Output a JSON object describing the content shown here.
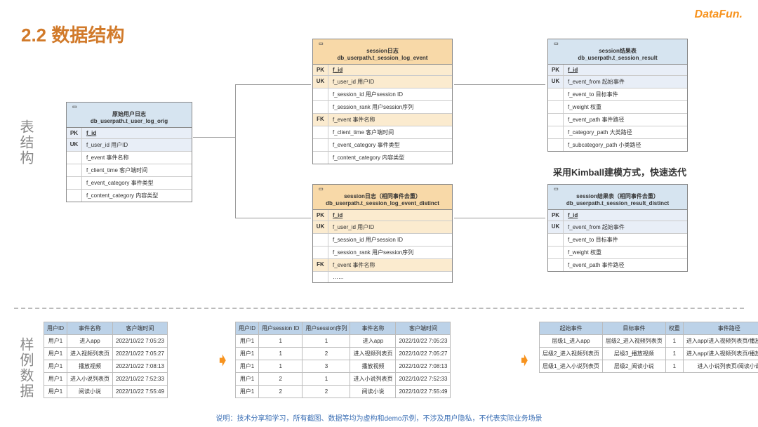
{
  "header": {
    "title": "2.2 数据结构",
    "logo": "DataFun."
  },
  "sideLabels": {
    "struct": "表结构",
    "sample": "样例数据"
  },
  "kimball_note": "采用Kimball建模方式，快速迭代",
  "footer": "说明：技术分享和学习，所有截图、数据等均为虚构和demo示例，不涉及用户隐私，不代表实际业务场景",
  "entities": {
    "orig": {
      "title1": "原始用户日志",
      "title2": "db_userpath.t_user_log_orig",
      "rows": [
        {
          "k": "PK",
          "v": "f_id"
        },
        {
          "k": "UK",
          "v": "f_user_id 用户ID"
        },
        {
          "k": "",
          "v": "f_event 事件名称"
        },
        {
          "k": "",
          "v": "f_client_time 客户端时间"
        },
        {
          "k": "",
          "v": "f_event_category 事件类型"
        },
        {
          "k": "",
          "v": "f_content_category 内容类型"
        }
      ]
    },
    "session_log": {
      "title1": "session日志",
      "title2": "db_userpath.t_session_log_event",
      "rows": [
        {
          "k": "PK",
          "v": "f_id"
        },
        {
          "k": "UK",
          "v": "f_user_id 用户ID"
        },
        {
          "k": "",
          "v": "f_session_id 用户session ID"
        },
        {
          "k": "",
          "v": "f_session_rank 用户session序列"
        },
        {
          "k": "FK",
          "v": "f_event 事件名称"
        },
        {
          "k": "",
          "v": "f_client_time 客户端时间"
        },
        {
          "k": "",
          "v": "f_event_category 事件类型"
        },
        {
          "k": "",
          "v": "f_content_category 内容类型"
        }
      ]
    },
    "session_result": {
      "title1": "session结果表",
      "title2": "db_userpath.t_session_result",
      "rows": [
        {
          "k": "PK",
          "v": "f_id"
        },
        {
          "k": "UK",
          "v": "f_event_from 起始事件"
        },
        {
          "k": "",
          "v": "f_event_to 目标事件"
        },
        {
          "k": "",
          "v": "f_weight 权重"
        },
        {
          "k": "",
          "v": "f_event_path 事件路径"
        },
        {
          "k": "",
          "v": "f_category_path 大类路径"
        },
        {
          "k": "",
          "v": "f_subcategory_path 小类路径"
        }
      ]
    },
    "session_log_distinct": {
      "title1": "session日志（相同事件去重）",
      "title2": "db_userpath.t_session_log_event_distinct",
      "rows": [
        {
          "k": "PK",
          "v": "f_id"
        },
        {
          "k": "UK",
          "v": "f_user_id 用户ID"
        },
        {
          "k": "",
          "v": "f_session_id 用户session ID"
        },
        {
          "k": "",
          "v": "f_session_rank 用户session序列"
        },
        {
          "k": "FK",
          "v": "f_event 事件名称"
        },
        {
          "k": "",
          "v": "……"
        }
      ]
    },
    "session_result_distinct": {
      "title1": "session结果表（相同事件去重）",
      "title2": "db_userpath.t_session_result_distinct",
      "rows": [
        {
          "k": "PK",
          "v": "f_id"
        },
        {
          "k": "UK",
          "v": "f_event_from 起始事件"
        },
        {
          "k": "",
          "v": "f_event_to 目标事件"
        },
        {
          "k": "",
          "v": "f_weight 权重"
        },
        {
          "k": "",
          "v": "f_event_path 事件路径"
        }
      ]
    }
  },
  "tables": {
    "t1": {
      "headers": [
        "用户ID",
        "事件名称",
        "客户端时间"
      ],
      "rows": [
        [
          "用户1",
          "进入app",
          "2022/10/22 7:05:23"
        ],
        [
          "用户1",
          "进入视频列表页",
          "2022/10/22 7:05:27"
        ],
        [
          "用户1",
          "播放视频",
          "2022/10/22 7:08:13"
        ],
        [
          "用户1",
          "进入小说列表页",
          "2022/10/22 7:52:33"
        ],
        [
          "用户1",
          "阅读小说",
          "2022/10/22 7:55:49"
        ]
      ]
    },
    "t2": {
      "headers": [
        "用户ID",
        "用户session ID",
        "用户session序列",
        "事件名称",
        "客户端时间"
      ],
      "rows": [
        [
          "用户1",
          "1",
          "1",
          "进入app",
          "2022/10/22 7:05:23"
        ],
        [
          "用户1",
          "1",
          "2",
          "进入视频列表页",
          "2022/10/22 7:05:27"
        ],
        [
          "用户1",
          "1",
          "3",
          "播放视频",
          "2022/10/22 7:08:13"
        ],
        [
          "用户1",
          "2",
          "1",
          "进入小说列表页",
          "2022/10/22 7:52:33"
        ],
        [
          "用户1",
          "2",
          "2",
          "阅读小说",
          "2022/10/22 7:55:49"
        ]
      ]
    },
    "t3": {
      "headers": [
        "起始事件",
        "目标事件",
        "权重",
        "事件路径"
      ],
      "rows": [
        [
          "层级1_进入app",
          "层级2_进入视频列表页",
          "1",
          "进入app/进入视频列表页/播放视频"
        ],
        [
          "层级2_进入视频列表页",
          "层级3_播放视频",
          "1",
          "进入app/进入视频列表页/播放视频"
        ],
        [
          "层级1_进入小说列表页",
          "层级2_阅读小说",
          "1",
          "进入小说列表页/阅读小说"
        ]
      ]
    }
  }
}
